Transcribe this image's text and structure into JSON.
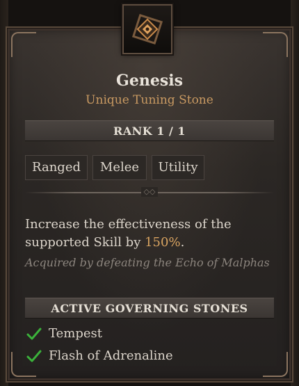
{
  "item": {
    "name": "Genesis",
    "type": "Unique Tuning Stone",
    "rank": "RANK 1 / 1",
    "tags": [
      "Ranged",
      "Melee",
      "Utility"
    ],
    "description_prefix": "Increase the effectiveness of the supported Skill by ",
    "description_value": "150%",
    "description_suffix": ".",
    "source": "Acquired by defeating the Echo of Malphas",
    "governing_header": "ACTIVE GOVERNING STONES",
    "governing_stones": [
      "Tempest",
      "Flash of Adrenaline"
    ],
    "icon": "tuning-stone-gem-icon",
    "check_icon": "check-icon"
  },
  "colors": {
    "name": "#e9e3da",
    "type": "#c99a62",
    "highlight": "#d9a461",
    "source": "#8c857e",
    "check": "#3bb23b"
  }
}
